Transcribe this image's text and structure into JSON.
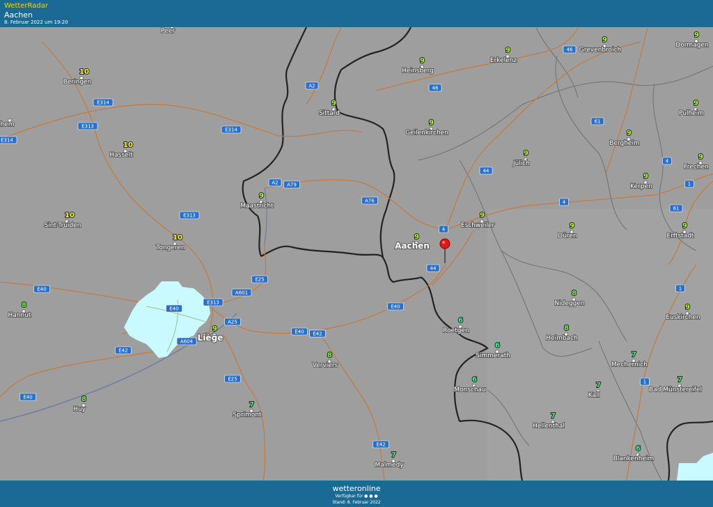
{
  "header": {
    "brand": "WetterRadar",
    "location": "Aachen",
    "datetime": "8. Februar 2022 um 19:20"
  },
  "footer": {
    "logo": "wetteronline",
    "availability": "Verfügbar für ● ● ●",
    "stand": "Stand: 8. Februar 2022"
  },
  "colors": {
    "header_bg": "#1b6a95",
    "map_bg": "#9e9e9e",
    "temp_10": "#ffff33",
    "temp_9": "#aaff33",
    "temp_8": "#66ff33",
    "temp_7": "#33ff66",
    "temp_6": "#33ff99",
    "precip_light": "#c8faff",
    "road": "#c8793a",
    "border": "#222222"
  },
  "marker": {
    "icon": "map-pin-icon",
    "label": "Aachen"
  },
  "cities": [
    {
      "name": "Peer"
    },
    {
      "name": "Beringen",
      "temp": "10"
    },
    {
      "name": "Hasselt",
      "temp": "10"
    },
    {
      "name": "Sint-Truiden",
      "temp": "10"
    },
    {
      "name": "Tongeren",
      "temp": "10"
    },
    {
      "name": "Hannut",
      "temp": "8"
    },
    {
      "name": "Huy",
      "temp": "8"
    },
    {
      "name": "Liège",
      "temp": "9"
    },
    {
      "name": "Maastricht",
      "temp": "9"
    },
    {
      "name": "Sittard",
      "temp": "9"
    },
    {
      "name": "Heinsberg",
      "temp": "9"
    },
    {
      "name": "Erkelenz",
      "temp": "9"
    },
    {
      "name": "Grevenbroich",
      "temp": "9"
    },
    {
      "name": "Dormagen",
      "temp": "9"
    },
    {
      "name": "Geilenkirchen",
      "temp": "9"
    },
    {
      "name": "Pulheim",
      "temp": "9"
    },
    {
      "name": "Bergheim",
      "temp": "9"
    },
    {
      "name": "Jülich",
      "temp": "9"
    },
    {
      "name": "Frechen",
      "temp": "9"
    },
    {
      "name": "Kerpen",
      "temp": "9"
    },
    {
      "name": "Eschweiler",
      "temp": "9"
    },
    {
      "name": "Düren",
      "temp": "9"
    },
    {
      "name": "Erftstadt",
      "temp": "9"
    },
    {
      "name": "Aachen",
      "temp": "9"
    },
    {
      "name": "Nideggen",
      "temp": "8"
    },
    {
      "name": "Euskirchen",
      "temp": "9"
    },
    {
      "name": "Roetgen",
      "temp": "6"
    },
    {
      "name": "Simmerath",
      "temp": "6"
    },
    {
      "name": "Heimbach",
      "temp": "8"
    },
    {
      "name": "Verviers",
      "temp": "8"
    },
    {
      "name": "Monschau",
      "temp": "6"
    },
    {
      "name": "Mechernich",
      "temp": "7"
    },
    {
      "name": "Kall",
      "temp": "7"
    },
    {
      "name": "Bad Münstereifel",
      "temp": "7"
    },
    {
      "name": "Sprimont",
      "temp": "7"
    },
    {
      "name": "Hellenthal",
      "temp": "7"
    },
    {
      "name": "Blankenheim",
      "temp": "6"
    },
    {
      "name": "Malmedy",
      "temp": "7"
    },
    {
      "name": "chem"
    }
  ],
  "roads": [
    "E314",
    "E314",
    "E313",
    "E314",
    "E313",
    "E40",
    "E40",
    "E313",
    "E40",
    "A601",
    "E25",
    "A25",
    "A604",
    "E42",
    "E40",
    "E42",
    "E40",
    "E42",
    "E25",
    "E42",
    "A2",
    "A2",
    "A79",
    "A76",
    "46",
    "46",
    "61",
    "44",
    "4",
    "4",
    "4",
    "44",
    "1",
    "1",
    "61",
    "1"
  ]
}
